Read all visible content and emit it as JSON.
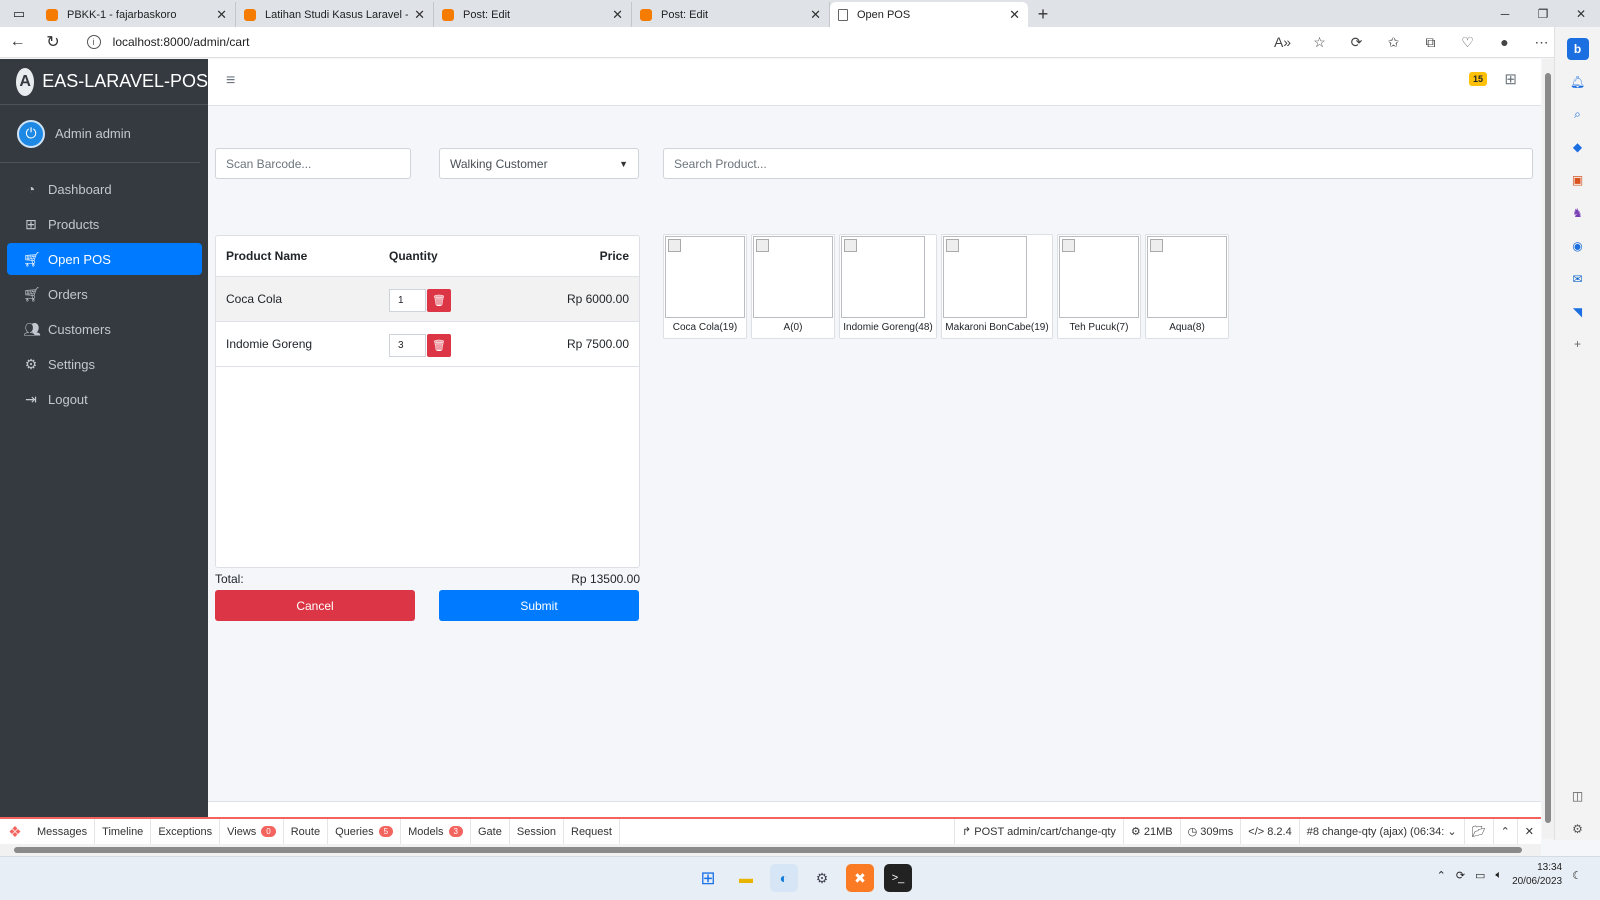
{
  "browser": {
    "tabs": [
      {
        "title": "PBKK-1 - fajarbaskoro",
        "icon": "blogger-icon"
      },
      {
        "title": "Latihan Studi Kasus Laravel - faja",
        "icon": "blogger-icon"
      },
      {
        "title": "Post: Edit",
        "icon": "blogger-icon"
      },
      {
        "title": "Post: Edit",
        "icon": "blogger-icon"
      },
      {
        "title": "Open POS",
        "icon": "page-icon",
        "active": true
      }
    ],
    "url": "localhost:8000/admin/cart"
  },
  "app": {
    "brand": "EAS-LARAVEL-POS",
    "user": "Admin admin",
    "nav": [
      {
        "label": "Dashboard",
        "icon": "dashboard-icon"
      },
      {
        "label": "Products",
        "icon": "grid-icon"
      },
      {
        "label": "Open POS",
        "icon": "cart-icon",
        "active": true
      },
      {
        "label": "Orders",
        "icon": "cart-icon"
      },
      {
        "label": "Customers",
        "icon": "users-icon"
      },
      {
        "label": "Settings",
        "icon": "gears-icon"
      },
      {
        "label": "Logout",
        "icon": "logout-icon"
      }
    ],
    "notifications": "15"
  },
  "pos": {
    "barcode_placeholder": "Scan Barcode...",
    "customer_selected": "Walking Customer",
    "search_placeholder": "Search Product...",
    "cart_headers": {
      "name": "Product Name",
      "qty": "Quantity",
      "price": "Price"
    },
    "cart_items": [
      {
        "name": "Coca Cola",
        "qty": "1",
        "price": "Rp 6000.00"
      },
      {
        "name": "Indomie Goreng",
        "qty": "3",
        "price": "Rp 7500.00"
      }
    ],
    "total_label": "Total:",
    "total_value": "Rp 13500.00",
    "cancel_label": "Cancel",
    "submit_label": "Submit",
    "products": [
      {
        "label": "Coca Cola(19)"
      },
      {
        "label": "A(0)"
      },
      {
        "label": "Indomie Goreng(48)"
      },
      {
        "label": "Makaroni BonCabe(19)"
      },
      {
        "label": "Teh Pucuk(7)"
      },
      {
        "label": "Aqua(8)"
      }
    ]
  },
  "debugbar": {
    "tabs": [
      {
        "label": "Messages"
      },
      {
        "label": "Timeline"
      },
      {
        "label": "Exceptions"
      },
      {
        "label": "Views",
        "badge": "0"
      },
      {
        "label": "Route"
      },
      {
        "label": "Queries",
        "badge": "5"
      },
      {
        "label": "Models",
        "badge": "3"
      },
      {
        "label": "Gate"
      },
      {
        "label": "Session"
      },
      {
        "label": "Request"
      }
    ],
    "route": "POST admin/cart/change-qty",
    "memory": "21MB",
    "time": "309ms",
    "php": "8.2.4",
    "request": "#8 change-qty (ajax) (06:34:"
  },
  "taskbar": {
    "time": "13:34",
    "date": "20/06/2023"
  },
  "colors": {
    "sidebar_bg": "#343a40",
    "primary": "#007bff",
    "danger": "#dc3545",
    "debug_accent": "#f4645f"
  }
}
